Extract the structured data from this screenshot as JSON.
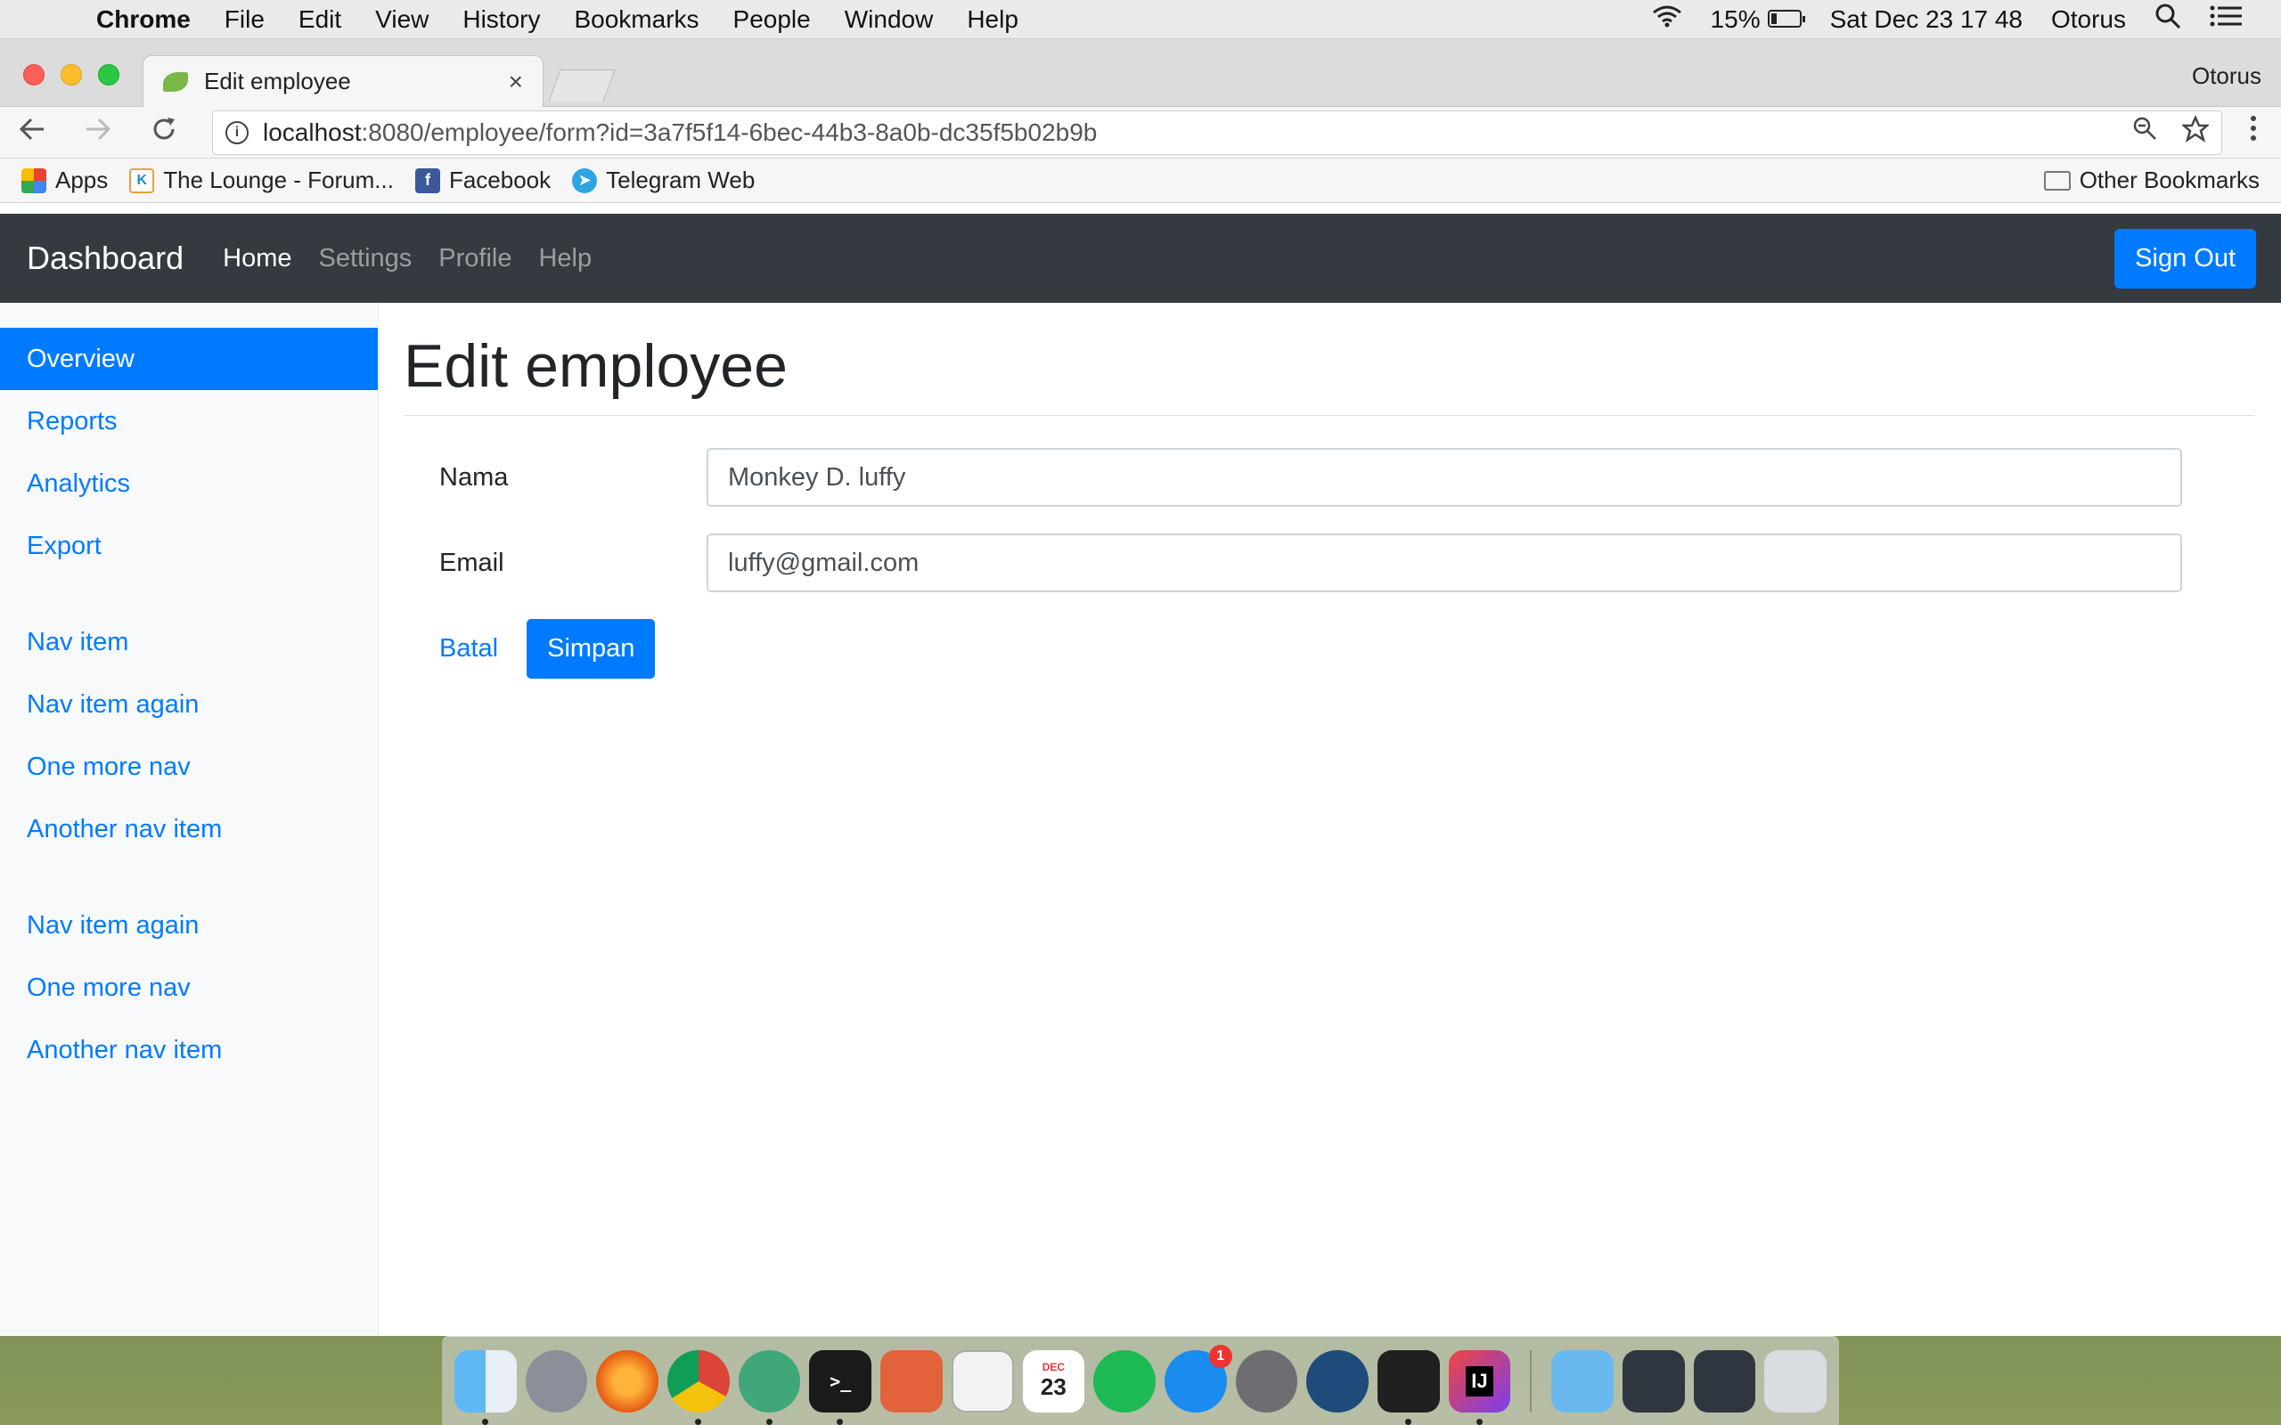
{
  "menubar": {
    "app": "Chrome",
    "items": [
      "File",
      "Edit",
      "View",
      "History",
      "Bookmarks",
      "People",
      "Window",
      "Help"
    ],
    "battery": "15%",
    "datetime": "Sat Dec 23  17 48",
    "user": "Otorus"
  },
  "browser": {
    "tab_title": "Edit employee",
    "tab_close": "×",
    "profile": "Otorus",
    "url_host": "localhost",
    "url_rest": ":8080/employee/form?id=3a7f5f14-6bec-44b3-8a0b-dc35f5b02b9b",
    "bookmarks": [
      "Apps",
      "The Lounge - Forum...",
      "Facebook",
      "Telegram Web"
    ],
    "other_bookmarks": "Other Bookmarks"
  },
  "navbar": {
    "brand": "Dashboard",
    "links": [
      "Home",
      "Settings",
      "Profile",
      "Help"
    ],
    "signout": "Sign Out"
  },
  "sidebar": {
    "group1": [
      "Overview",
      "Reports",
      "Analytics",
      "Export"
    ],
    "group2": [
      "Nav item",
      "Nav item again",
      "One more nav",
      "Another nav item"
    ],
    "group3": [
      "Nav item again",
      "One more nav",
      "Another nav item"
    ]
  },
  "main": {
    "title": "Edit employee",
    "fields": [
      {
        "label": "Nama",
        "value": "Monkey D. luffy"
      },
      {
        "label": "Email",
        "value": "luffy@gmail.com"
      }
    ],
    "cancel": "Batal",
    "save": "Simpan"
  },
  "dock": {
    "calendar_month": "DEC",
    "calendar_day": "23",
    "appstore_badge": "1",
    "terminal_label": ">_",
    "intellij_label": "IJ"
  }
}
